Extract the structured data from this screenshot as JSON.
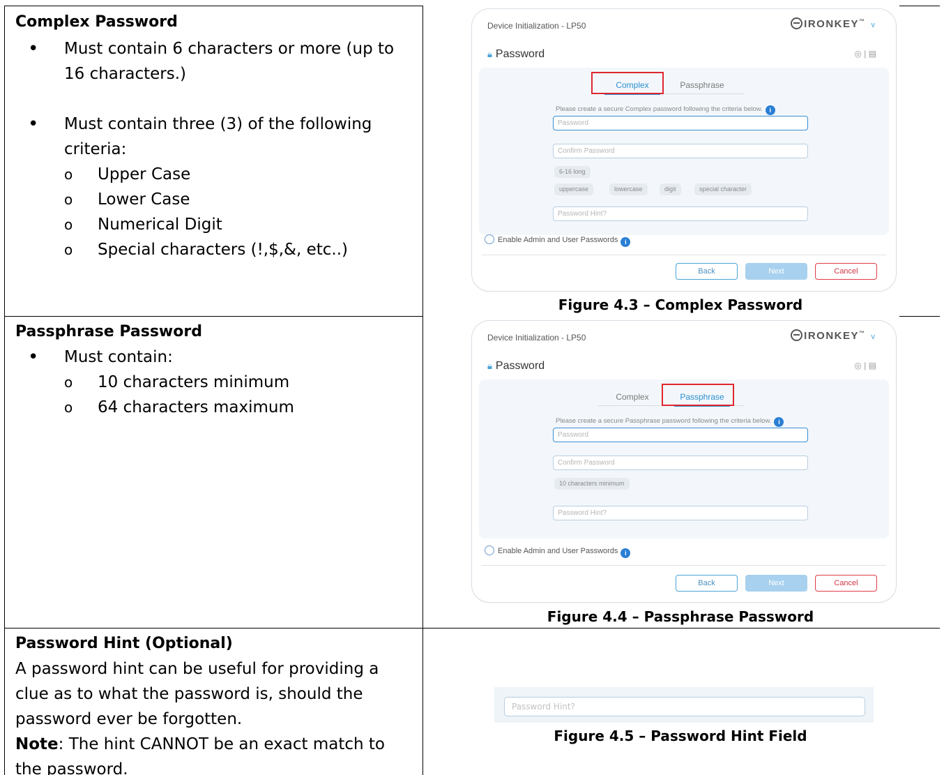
{
  "rows": [
    {
      "title": "Complex Password",
      "bullets": [
        {
          "text": "Must contain 6 characters or more (up to 16 characters.)"
        },
        {
          "text": "Must contain three (3) of the following criteria:",
          "sub": [
            "Upper Case",
            "Lower Case",
            "Numerical Digit",
            "Special characters (!,$,&, etc..)"
          ]
        }
      ],
      "caption": "Figure 4.3 – Complex Password"
    },
    {
      "title": "Passphrase Password",
      "bullets": [
        {
          "text": "Must contain:",
          "sub": [
            "10 characters minimum",
            "64 characters maximum"
          ]
        }
      ],
      "caption": "Figure 4.4 – Passphrase Password"
    },
    {
      "title": "Password Hint (Optional)",
      "para": "A password hint can be useful for providing a clue as to what the password is, should the password ever be forgotten.",
      "note_label": "Note",
      "note_text": ": The hint CANNOT be an exact match to the password.",
      "caption": "Figure 4.5 – Password Hint Field",
      "hint_placeholder": "Password Hint?"
    }
  ],
  "dialog": {
    "window_title": "Device Initialization - LP50",
    "brand": "IRONKEY",
    "brand_mark": "™",
    "section": "Password",
    "tabs": [
      "Complex",
      "Passphrase"
    ],
    "fields": {
      "password": "Password",
      "confirm": "Confirm Password",
      "hint": "Password Hint?"
    },
    "enable_admin": "Enable Admin and User Passwords",
    "buttons": {
      "back": "Back",
      "next": "Next",
      "cancel": "Cancel"
    },
    "info_glyph": "i",
    "chevron": "v"
  },
  "complex_dialog": {
    "criteria_text": "Please create a secure Complex password following the criteria below.",
    "chips_row1": [
      "6-16 long"
    ],
    "chips_row2": [
      "uppercase",
      "lowercase",
      "digit",
      "special character"
    ]
  },
  "passphrase_dialog": {
    "criteria_text": "Please create a secure Passphrase password following the criteria below.",
    "chips_row1": [
      "10 characters minimum"
    ]
  },
  "colors": {
    "accent": "#2a8fd0",
    "highlight_box": "#e0262f",
    "cancel": "#d23443"
  }
}
